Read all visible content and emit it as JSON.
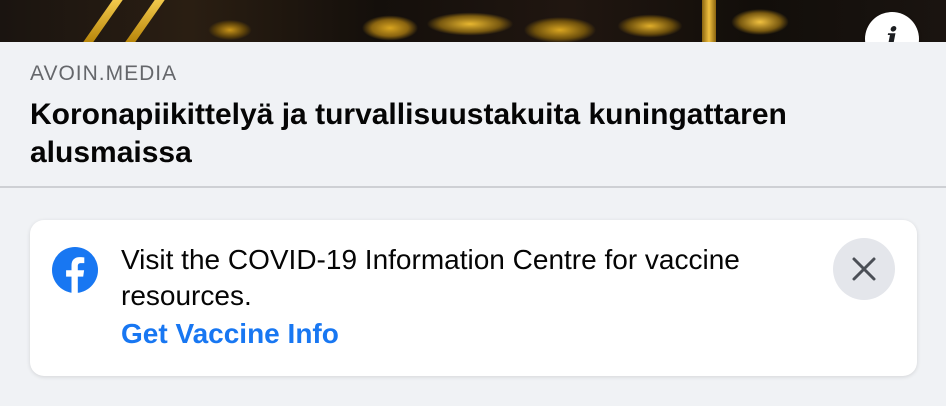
{
  "hero": {
    "info_icon": "info-icon",
    "info_glyph": "i"
  },
  "link_preview": {
    "source": "AVOIN.MEDIA",
    "headline": "Koronapiikittelyä ja turvallisuustakuita kuningattaren alusmaissa"
  },
  "covid_card": {
    "icon": "facebook-icon",
    "message": "Visit the COVID-19 Information Centre for vaccine resources.",
    "link_label": "Get Vaccine Info",
    "close_icon": "close-icon"
  },
  "colors": {
    "accent": "#1877f2",
    "background": "#f0f2f5",
    "card": "#ffffff",
    "secondary_text": "#65676b",
    "close_bg": "#e4e6eb"
  }
}
